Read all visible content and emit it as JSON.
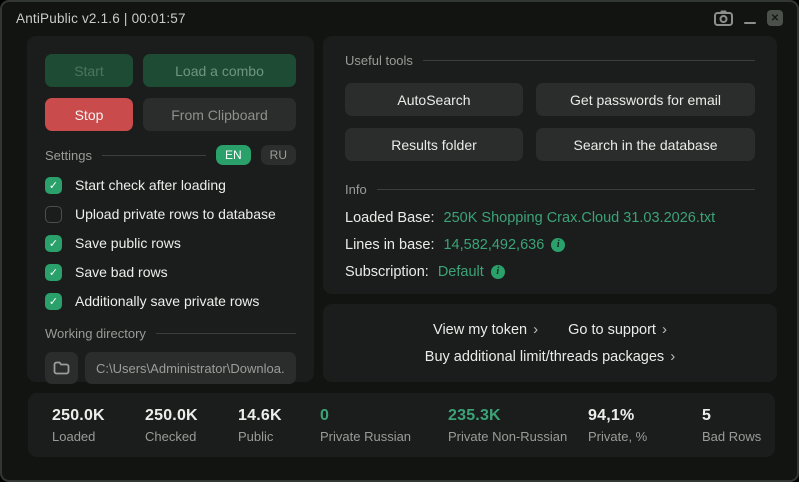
{
  "window": {
    "title": "AntiPublic v2.1.6 | 00:01:57",
    "close_glyph": "✕"
  },
  "icons": {
    "camera": "camera-icon",
    "minimize": "minimize-icon",
    "close": "close-icon",
    "folder": "folder-icon",
    "info_glyph": "i",
    "check_glyph": "✓"
  },
  "left_panel": {
    "buttons": {
      "start": "Start",
      "load_combo": "Load a combo",
      "stop": "Stop",
      "from_clipboard": "From Clipboard"
    },
    "settings": {
      "label": "Settings",
      "languages": [
        {
          "label": "EN",
          "active": true
        },
        {
          "label": "RU",
          "active": false
        }
      ],
      "checkboxes": [
        {
          "label": "Start check after loading",
          "checked": true
        },
        {
          "label": "Upload private rows to database",
          "checked": false
        },
        {
          "label": "Save public rows",
          "checked": true
        },
        {
          "label": "Save bad rows",
          "checked": true
        },
        {
          "label": "Additionally save private rows",
          "checked": true
        }
      ]
    },
    "working_directory": {
      "label": "Working directory",
      "path": "C:\\Users\\Administrator\\Downloa..."
    }
  },
  "tools": {
    "label": "Useful tools",
    "buttons": [
      "AutoSearch",
      "Get passwords for email",
      "Results folder",
      "Search in the database"
    ]
  },
  "info": {
    "label": "Info",
    "rows": [
      {
        "label": "Loaded Base:",
        "value": "250K Shopping Crax.Cloud 31.03.2026.txt"
      },
      {
        "label": "Lines in base:",
        "value": "14,582,492,636"
      },
      {
        "label": "Subscription:",
        "value": "Default"
      }
    ]
  },
  "links": {
    "view_token": "View my token",
    "support": "Go to support",
    "buy": "Buy additional limit/threads packages",
    "chevron": "›"
  },
  "stats": [
    {
      "value": "250.0K",
      "label": "Loaded"
    },
    {
      "value": "250.0K",
      "label": "Checked"
    },
    {
      "value": "14.6K",
      "label": "Public"
    },
    {
      "value": "0",
      "label": "Private Russian"
    },
    {
      "value": "235.3K",
      "label": "Private Non-Russian"
    },
    {
      "value": "94,1%",
      "label": "Private, %"
    },
    {
      "value": "5",
      "label": "Bad Rows"
    }
  ],
  "colors": {
    "accent_green": "#2aa06a",
    "value_green": "#3ba377",
    "stop_red": "#c94b4b",
    "dark_green_button": "#1d4b34",
    "panel_bg": "#1b1d1c",
    "window_bg": "#121412"
  }
}
